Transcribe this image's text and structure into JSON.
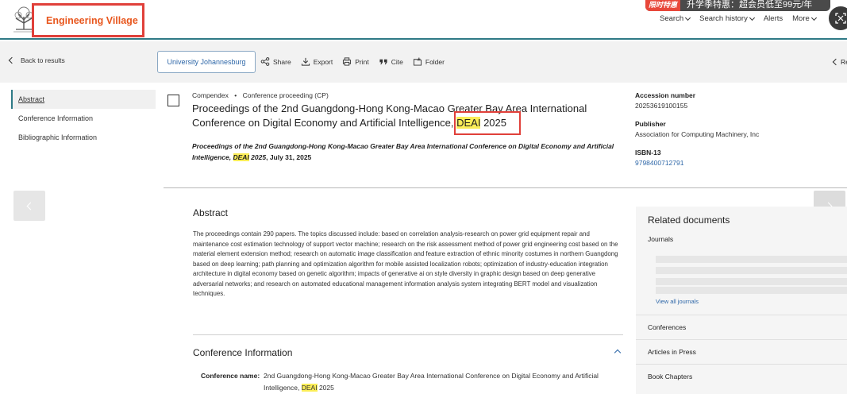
{
  "header": {
    "brand": "Engineering Village",
    "promo_tag": "限时特惠",
    "promo_text": "升学季特惠：超会员低至99元/年",
    "nav": [
      {
        "label": "Search",
        "dropdown": true
      },
      {
        "label": "Search history",
        "dropdown": true
      },
      {
        "label": "Alerts",
        "dropdown": false
      },
      {
        "label": "More",
        "dropdown": true
      }
    ]
  },
  "toolbar": {
    "back_label": "Back to results",
    "institution": "University Johannesburg",
    "share": "Share",
    "export": "Export",
    "print": "Print",
    "cite": "Cite",
    "folder": "Folder",
    "next_label": "Re"
  },
  "sidebar": {
    "items": [
      {
        "label": "Abstract",
        "active": true
      },
      {
        "label": "Conference Information",
        "active": false
      },
      {
        "label": "Bibliographic Information",
        "active": false
      }
    ]
  },
  "record": {
    "database": "Compendex",
    "separator": "•",
    "doc_type": "Conference proceeding (CP)",
    "title_main": "Proceedings of the 2nd Guangdong-Hong Kong-Macao Greater Bay Area International Conference on Digital Economy and Artificial Intelligence, ",
    "title_highlight": "DEAI",
    "title_end": " 2025",
    "source_main": "Proceedings of the 2nd Guangdong-Hong Kong-Macao Greater Bay Area International Conference on Digital Economy and Artificial Intelligence, ",
    "source_highlight": "DEAI",
    "source_end": " 2025",
    "source_date": ", July 31, 2025"
  },
  "meta": {
    "accession_label": "Accession number",
    "accession_value": "20253619100155",
    "publisher_label": "Publisher",
    "publisher_value": "Association for Computing Machinery, Inc",
    "isbn_label": "ISBN-13",
    "isbn_value": "9798400712791"
  },
  "abstract": {
    "heading": "Abstract",
    "text": "The proceedings contain 290 papers. The topics discussed include: based on correlation analysis-research on power grid equipment repair and maintenance cost estimation technology of support vector machine; research on the risk assessment method of power grid engineering cost based on the material element extension method; research on automatic image classification and feature extraction of ethnic minority costumes in northern Guangdong based on deep learning; path planning and optimization algorithm for mobile assisted localization robots; optimization of industry-education integration architecture in digital economy based on genetic algorithm; impacts of generative ai on style diversity in graphic design based on deep generative adversarial networks; and research on automated educational management information analysis system integrating BERT model and visualization techniques."
  },
  "conference": {
    "heading": "Conference Information",
    "name_label": "Conference name:",
    "name_main": "2nd Guangdong-Hong Kong-Macao Greater Bay Area International Conference on Digital Economy and Artificial Intelligence, ",
    "name_highlight": "DEAI",
    "name_end": " 2025"
  },
  "related": {
    "heading": "Related documents",
    "journals_label": "Journals",
    "view_all": "View all journals",
    "sections": [
      "Conferences",
      "Articles in Press",
      "Book Chapters"
    ]
  }
}
